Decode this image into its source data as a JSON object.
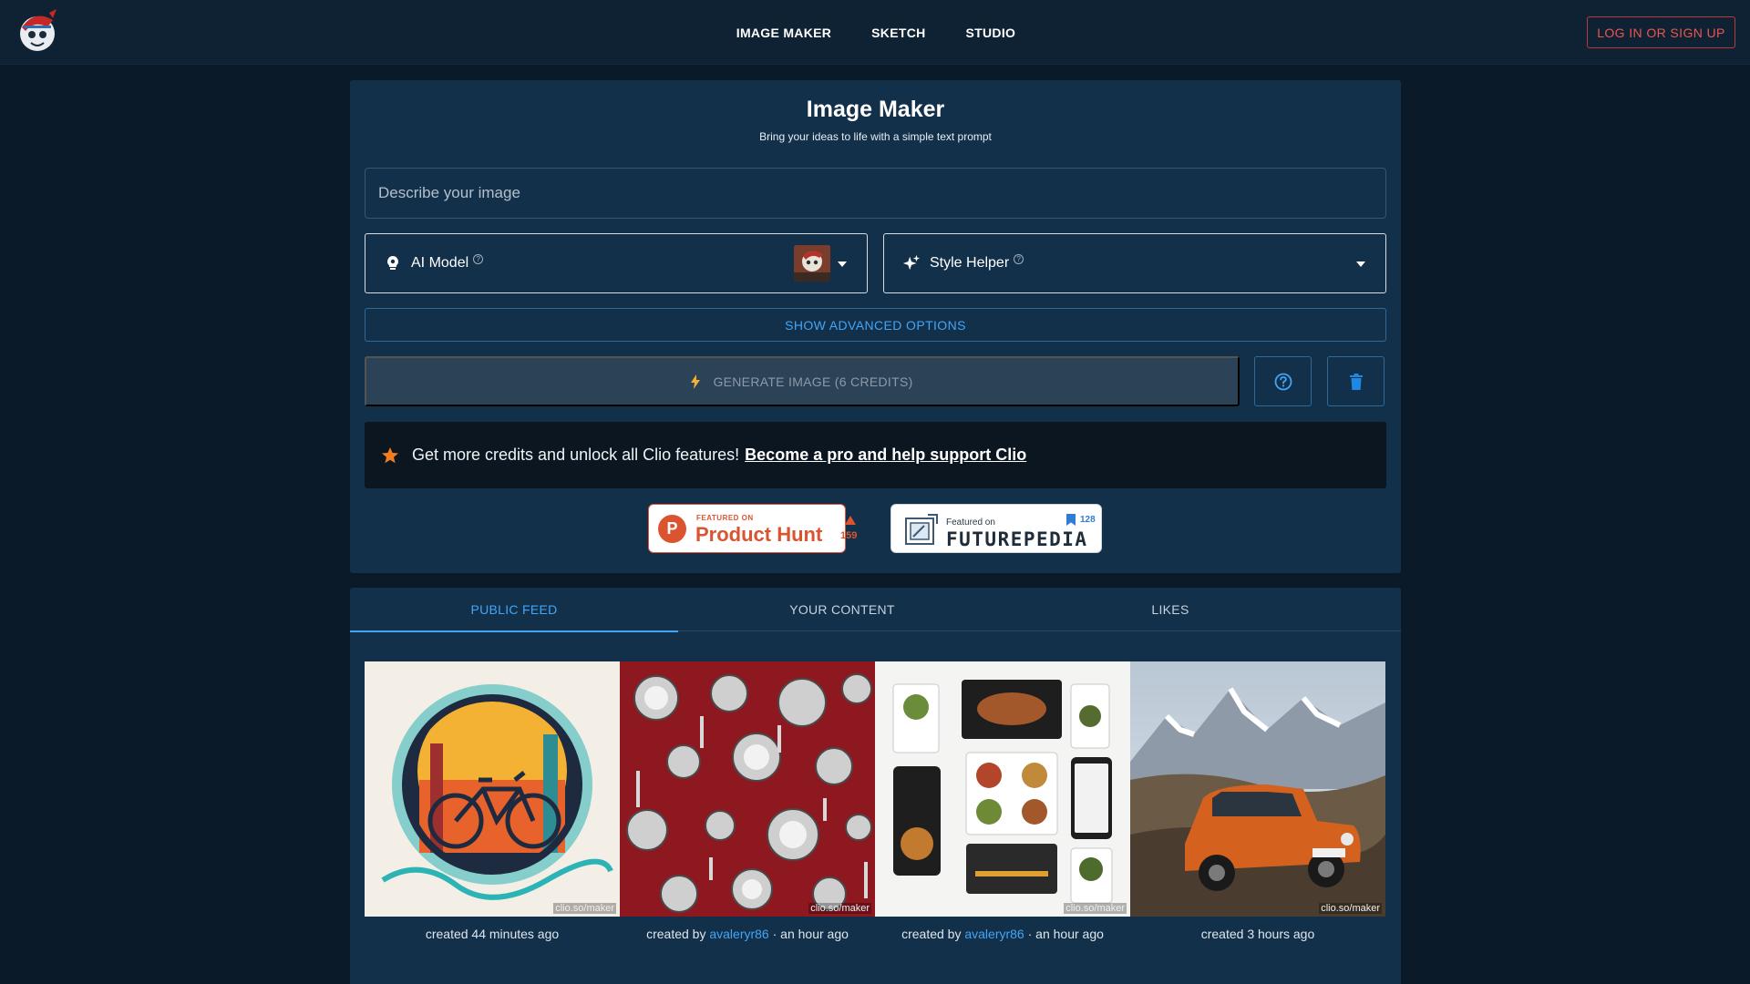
{
  "nav": {
    "items": [
      "IMAGE MAKER",
      "SKETCH",
      "STUDIO"
    ],
    "login_label": "LOG IN OR SIGN UP"
  },
  "maker": {
    "title": "Image Maker",
    "subtitle": "Bring your ideas to life with a simple text prompt",
    "prompt_placeholder": "Describe your image",
    "model_label": "AI Model",
    "style_label": "Style Helper",
    "advanced_label": "SHOW ADVANCED OPTIONS",
    "generate_label": "GENERATE IMAGE (6 CREDITS)",
    "promo_text": "Get more credits and unlock all Clio features!",
    "promo_link": "Become a pro and help support Clio"
  },
  "badges": {
    "producthunt": {
      "small": "FEATURED ON",
      "big": "Product Hunt",
      "count": "159"
    },
    "futurepedia": {
      "small": "Featured on",
      "big": "FUTUREPEDIA",
      "count": "128"
    }
  },
  "feed": {
    "tabs": [
      "PUBLIC FEED",
      "YOUR CONTENT",
      "LIKES"
    ],
    "active_tab": "PUBLIC FEED",
    "watermark": "clio.so/maker",
    "items": [
      {
        "prefix": "created",
        "user": "",
        "time": "44 minutes ago"
      },
      {
        "prefix": "created by",
        "user": "avaleryr86",
        "time": "an hour ago"
      },
      {
        "prefix": "created by",
        "user": "avaleryr86",
        "time": "an hour ago"
      },
      {
        "prefix": "created",
        "user": "",
        "time": "3 hours ago"
      }
    ]
  },
  "colors": {
    "background": "#0b1a28",
    "card": "#13304a",
    "accent": "#42a5f5",
    "login": "#ef5350",
    "promo_star": "#f57c1f"
  },
  "icons": {
    "model": "lightbulb-icon",
    "style": "sparkles-icon",
    "generate": "bolt-icon",
    "help": "question-circle-icon",
    "delete": "trash-icon",
    "promo": "star-icon"
  }
}
